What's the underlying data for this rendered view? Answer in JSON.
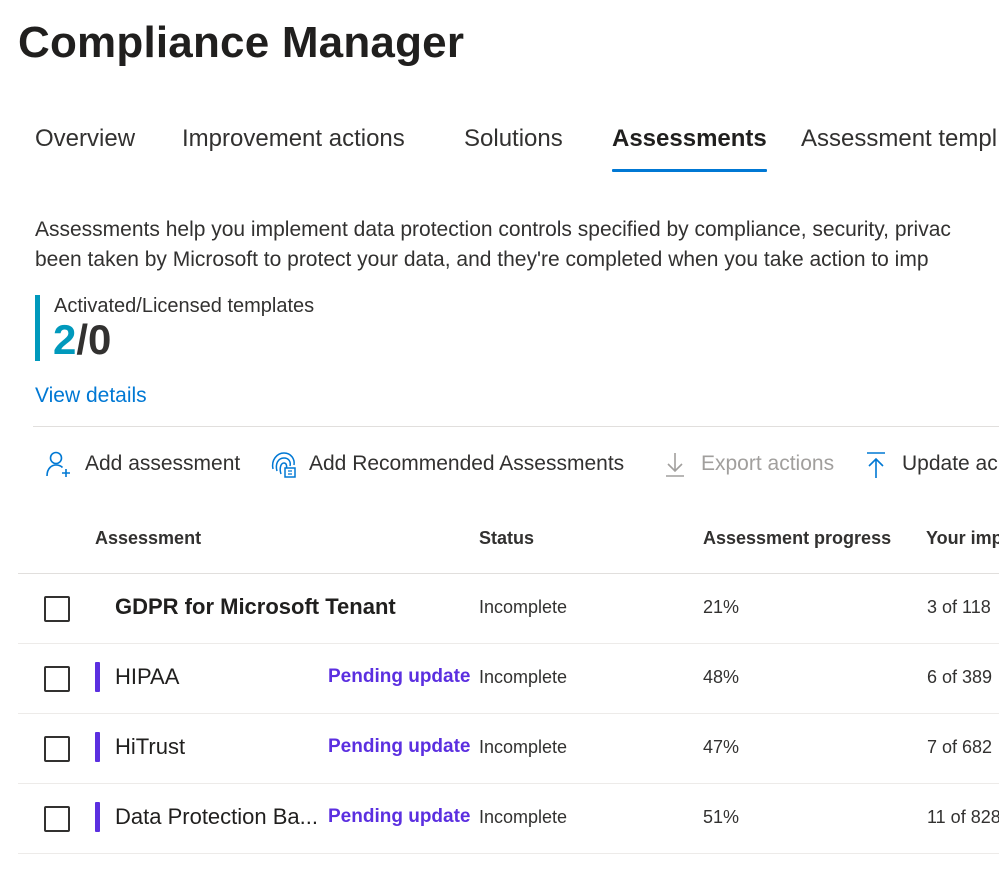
{
  "page": {
    "title": "Compliance Manager"
  },
  "tabs": [
    {
      "label": "Overview"
    },
    {
      "label": "Improvement actions"
    },
    {
      "label": "Solutions"
    },
    {
      "label": "Assessments"
    },
    {
      "label": "Assessment templ"
    }
  ],
  "description": {
    "line1": "Assessments help you implement data protection controls specified by compliance, security, privac",
    "line2": "been taken by Microsoft to protect your data, and they're completed when you take action to imp"
  },
  "metric": {
    "label": "Activated/Licensed templates",
    "activated": "2",
    "licensed_part": "/0",
    "accent_color": "#0099bc"
  },
  "view_details": "View details",
  "toolbar": {
    "add_assessment": {
      "label": "Add assessment",
      "icon": "add-person-icon"
    },
    "add_recommended": {
      "label": "Add Recommended Assessments",
      "icon": "fingerprint-icon"
    },
    "export_actions": {
      "label": "Export actions",
      "icon": "download-icon"
    },
    "update": {
      "label": "Update ac",
      "icon": "upload-icon"
    }
  },
  "table": {
    "columns": [
      "Assessment",
      "Status",
      "Assessment progress",
      "Your imp"
    ],
    "rows": [
      {
        "name": "GDPR for Microsoft Tenant",
        "badge": "",
        "status": "Incomplete",
        "progress": "21%",
        "implemented": "3 of 118"
      },
      {
        "name": "HIPAA",
        "badge": "Pending update",
        "status": "Incomplete",
        "progress": "48%",
        "implemented": "6 of 389"
      },
      {
        "name": "HiTrust",
        "badge": "Pending update",
        "status": "Incomplete",
        "progress": "47%",
        "implemented": "7 of 682"
      },
      {
        "name": "Data Protection Ba...",
        "badge": "Pending update",
        "status": "Incomplete",
        "progress": "51%",
        "implemented": "11 of 828"
      }
    ]
  },
  "colors": {
    "accent_blue": "#0078d4",
    "pending_purple": "#5b2fe0"
  }
}
